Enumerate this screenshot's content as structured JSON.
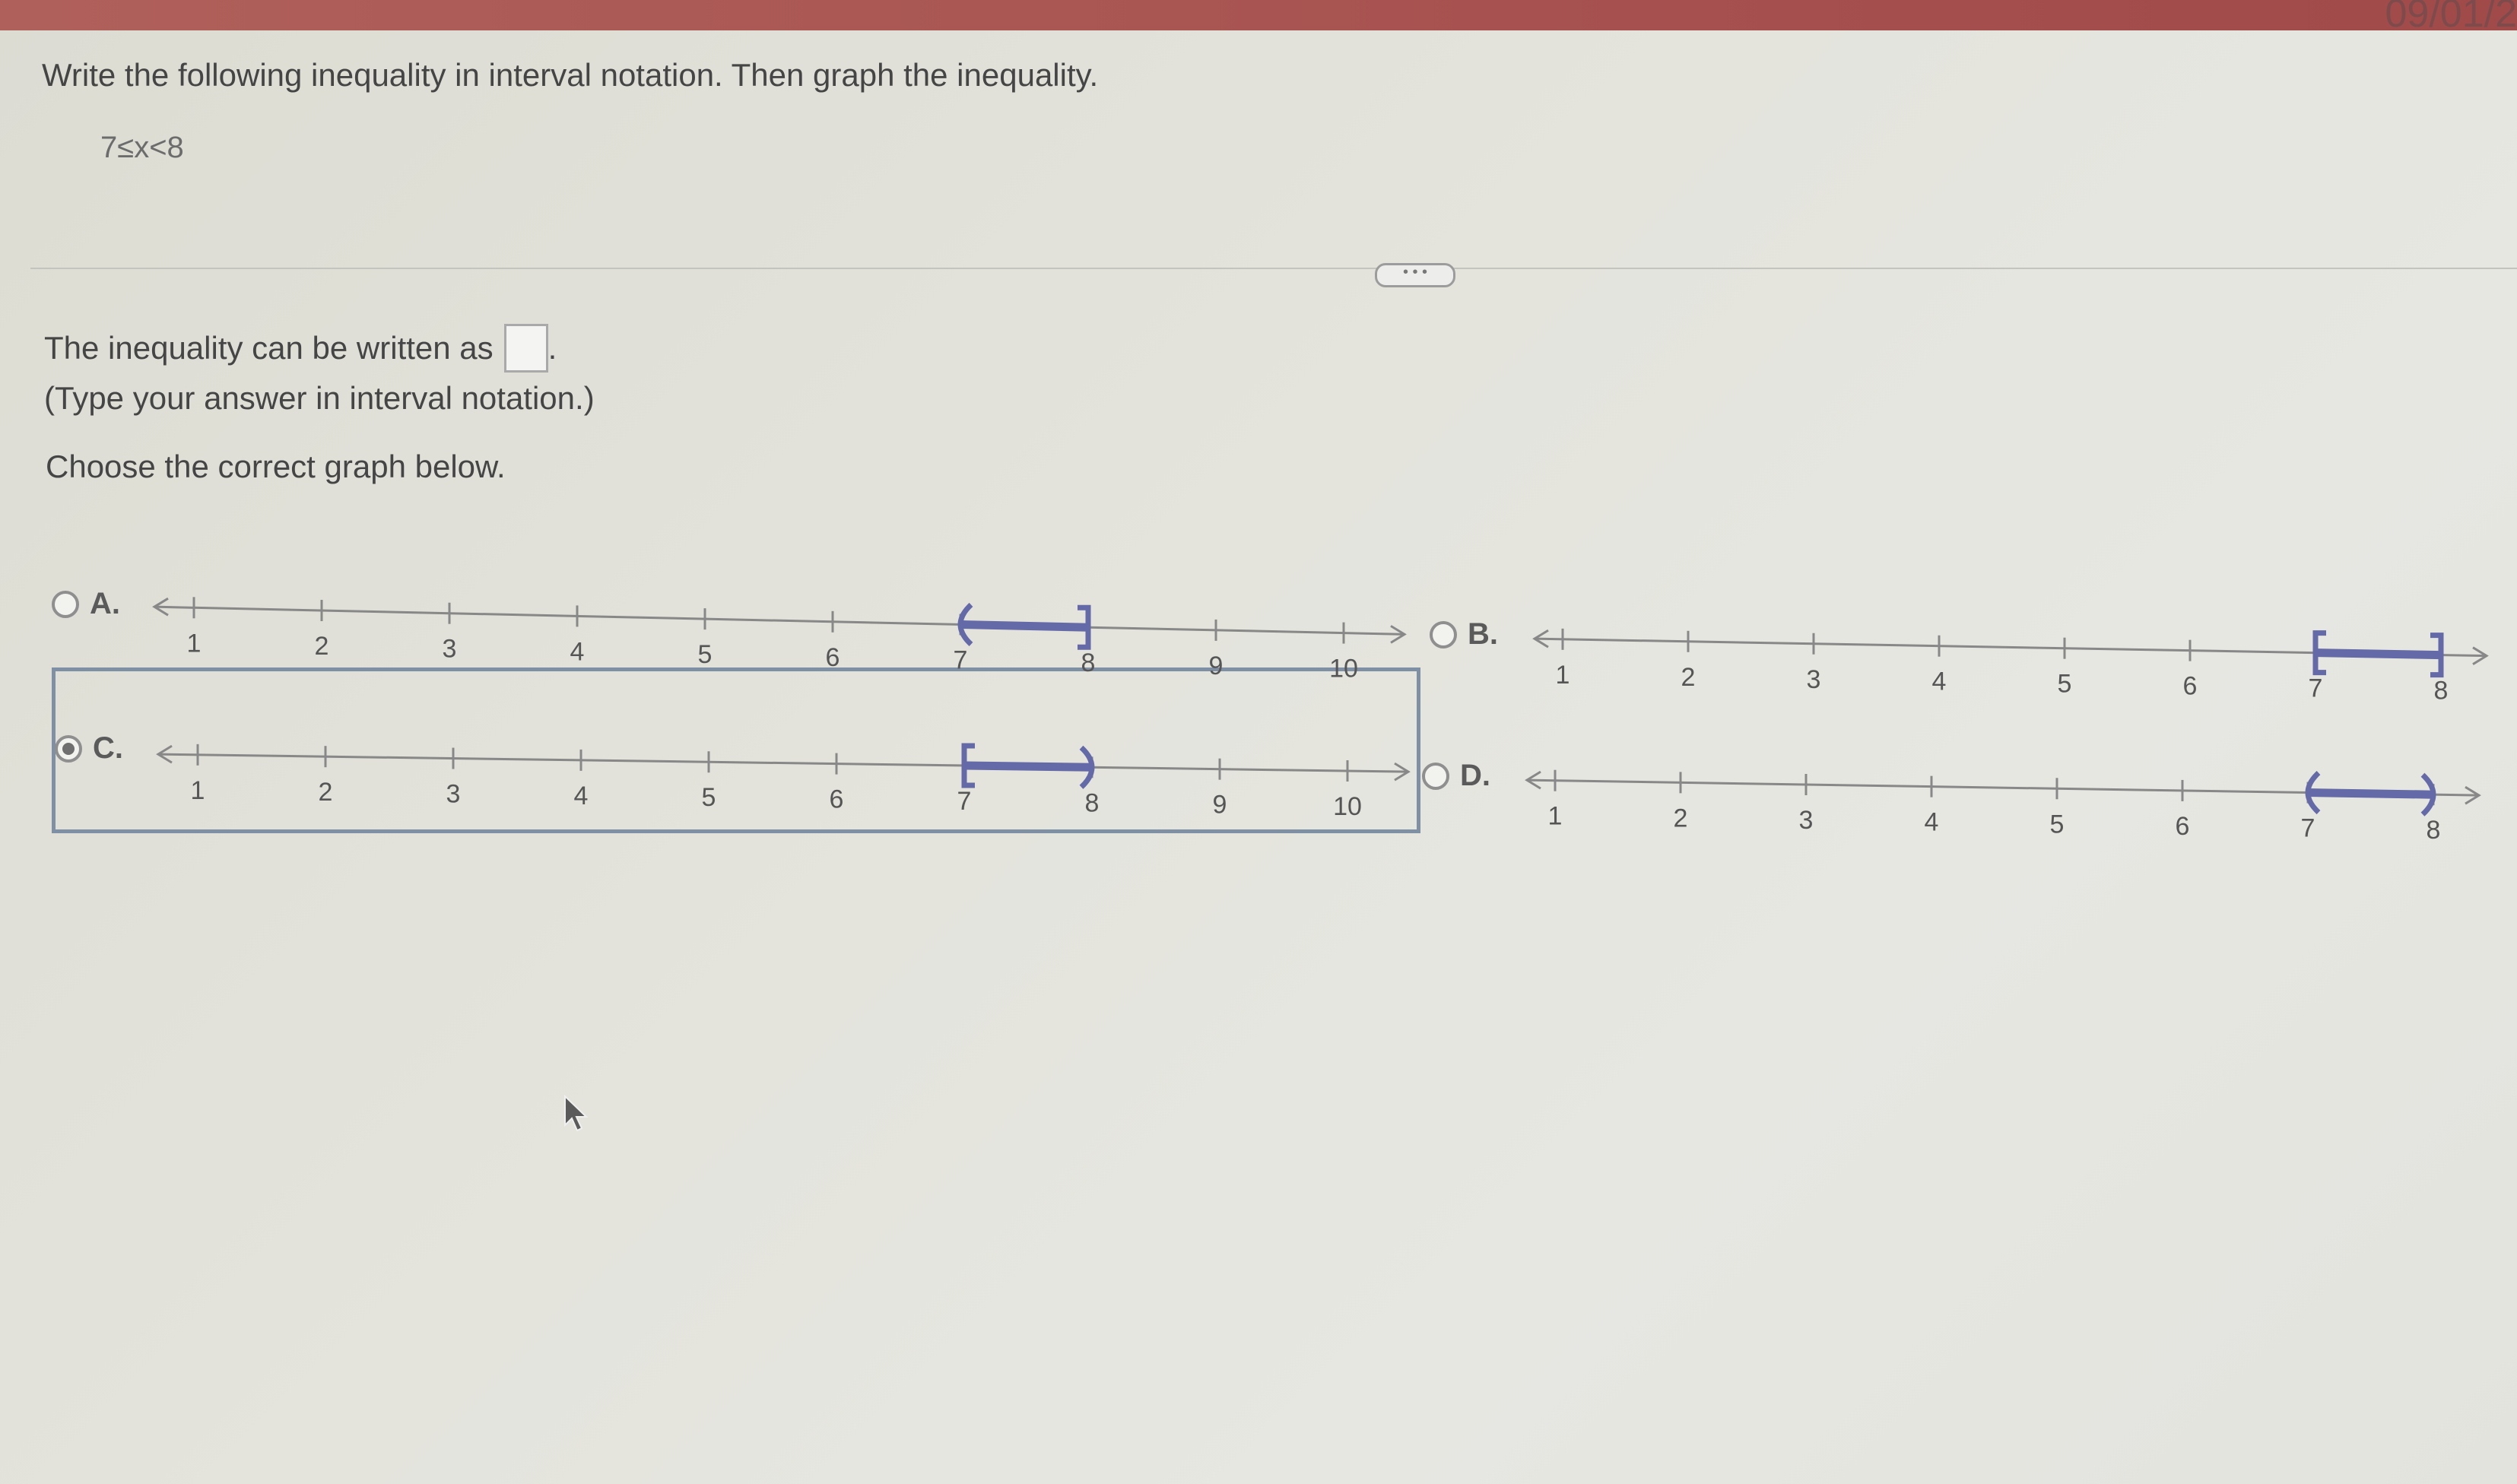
{
  "header": {
    "right_text": "09/01/2"
  },
  "question": {
    "instruction": "Write the following inequality in interval notation. Then graph the inequality.",
    "expression": "7≤x<8"
  },
  "answer": {
    "prefix": "The inequality can be written as",
    "suffix": ".",
    "input_value": "",
    "hint": "(Type your answer in interval notation.)"
  },
  "choose_prompt": "Choose the correct graph below.",
  "more_button_label": "• • •",
  "options": [
    {
      "letter": "A.",
      "selected": false,
      "ticks": [
        "1",
        "2",
        "3",
        "4",
        "5",
        "6",
        "7",
        "8",
        "9",
        "10"
      ],
      "interval": [
        7,
        8
      ],
      "left_end": "(",
      "right_end": "]"
    },
    {
      "letter": "B.",
      "selected": false,
      "ticks": [
        "1",
        "2",
        "3",
        "4",
        "5",
        "6",
        "7",
        "8"
      ],
      "interval": [
        7,
        8
      ],
      "left_end": "[",
      "right_end": "]"
    },
    {
      "letter": "C.",
      "selected": true,
      "ticks": [
        "1",
        "2",
        "3",
        "4",
        "5",
        "6",
        "7",
        "8",
        "9",
        "10"
      ],
      "interval": [
        7,
        8
      ],
      "left_end": "[",
      "right_end": ")"
    },
    {
      "letter": "D.",
      "selected": false,
      "ticks": [
        "1",
        "2",
        "3",
        "4",
        "5",
        "6",
        "7",
        "8"
      ],
      "interval": [
        7,
        8
      ],
      "left_end": "(",
      "right_end": ")"
    }
  ],
  "colors": {
    "interval": "#6469a8",
    "axis": "#888888",
    "selection": "#7f8fa4"
  }
}
